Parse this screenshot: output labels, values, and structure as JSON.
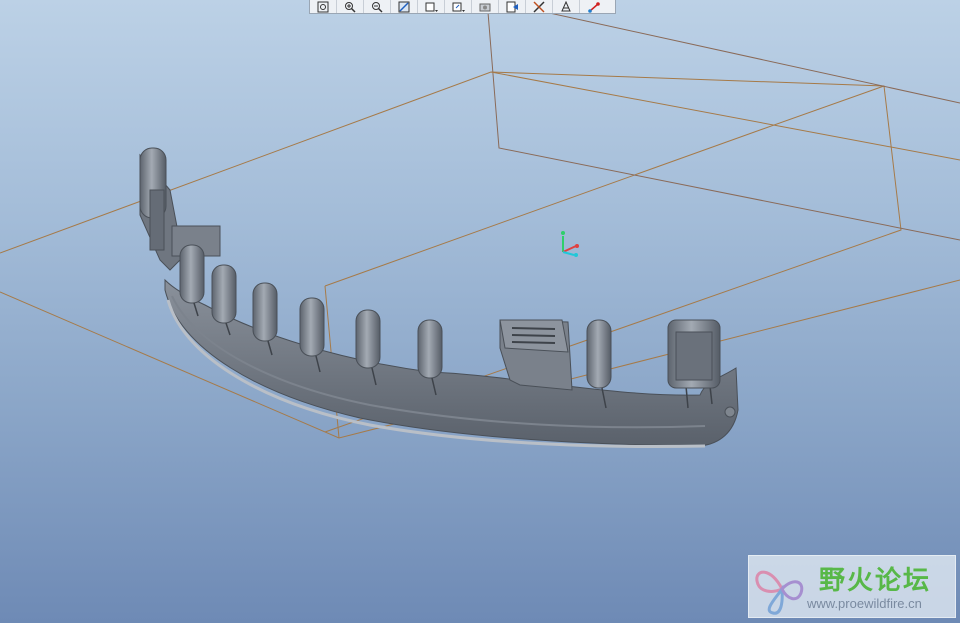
{
  "toolbar": {
    "buttons": [
      {
        "icon": "zoom-fit-icon"
      },
      {
        "icon": "zoom-in-icon"
      },
      {
        "icon": "zoom-out-icon"
      },
      {
        "icon": "repaint-icon"
      },
      {
        "icon": "display-style-icon"
      },
      {
        "icon": "saved-views-icon"
      },
      {
        "icon": "layer-icon"
      },
      {
        "icon": "datum-plane-display-icon"
      },
      {
        "icon": "datum-axis-display-icon"
      },
      {
        "icon": "point-display-icon"
      },
      {
        "icon": "csys-display-icon"
      }
    ]
  },
  "viewport": {
    "background_top": "#bcd1e6",
    "background_bottom": "#6e8ab5",
    "datum_plane_color": "#b07a3c",
    "model_color": "#6f7680"
  },
  "watermark": {
    "title": "野火论坛",
    "url": "www.proewildfire.cn"
  }
}
